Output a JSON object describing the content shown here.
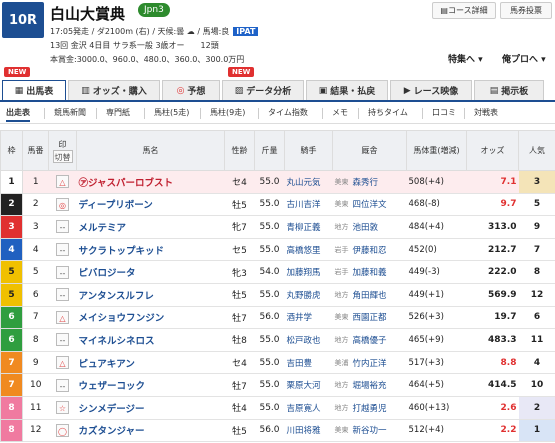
{
  "race": {
    "number": "10R",
    "title": "白山大賞典",
    "grade": "Jpn3",
    "line1": "17:05発走 / ダ2100m (右) / 天候:曇 ☁ / 馬場:良",
    "ipat": "IPAT",
    "line2": "13回 金沢 4日目 サラ系一般 3歳オー　　12頭",
    "line3": "本賞金:3000.0、960.0、480.0、360.0、300.0万円"
  },
  "top_buttons": {
    "course": "コース詳細",
    "vote": "馬券投票"
  },
  "top_links": {
    "special": "特集へ",
    "mypro": "俺プロへ"
  },
  "tabs": [
    "出馬表",
    "オッズ・購入",
    "予想",
    "データ分析",
    "結果・払戻",
    "レース映像",
    "掲示板"
  ],
  "new_label": "NEW",
  "subtabs": [
    "出走表",
    "競馬新聞",
    "専門紙",
    "馬柱(5走)",
    "馬柱(9走)",
    "タイム指数",
    "メモ",
    "持ちタイム",
    "口コミ",
    "対戦表"
  ],
  "headers": {
    "waku": "枠",
    "umaban": "馬番",
    "mark": "印",
    "mark_sub": "切替",
    "name": "馬名",
    "sexage": "性齢",
    "kinryo": "斤量",
    "jockey": "騎手",
    "trainer": "厩舎",
    "weight": "馬体重(増減)",
    "odds": "オッズ",
    "ninki": "人気"
  },
  "colors": {
    "w1": "#ffffff",
    "w2": "#222222",
    "w3": "#e03030",
    "w4": "#2060c0",
    "w5": "#f0c000",
    "w6": "#2f9e3f",
    "w7": "#f08a20",
    "w8": "#f07aa0"
  },
  "horses": [
    {
      "waku": "1",
      "umaban": "1",
      "mark": "△",
      "name": "㋐ジャスパーロブスト",
      "sexage": "セ4",
      "kinryo": "55.0",
      "jockey": "丸山元気",
      "belong": "美東",
      "trainer": "森秀行",
      "weight": "508(+4)",
      "odds": "7.1",
      "ninki": "3"
    },
    {
      "waku": "2",
      "umaban": "2",
      "mark": "◎",
      "name": "ディープリボーン",
      "sexage": "牡5",
      "kinryo": "55.0",
      "jockey": "古川吉洋",
      "belong": "美東",
      "trainer": "四位洋文",
      "weight": "468(-8)",
      "odds": "9.7",
      "ninki": "5"
    },
    {
      "waku": "3",
      "umaban": "3",
      "mark": "--",
      "name": "メルテミア",
      "sexage": "牝7",
      "kinryo": "55.0",
      "jockey": "青柳正義",
      "belong": "地方",
      "trainer": "池田敦",
      "weight": "484(+4)",
      "odds": "313.0",
      "ninki": "9"
    },
    {
      "waku": "4",
      "umaban": "4",
      "mark": "--",
      "name": "サクラトップキッド",
      "sexage": "セ5",
      "kinryo": "55.0",
      "jockey": "高橋悠里",
      "belong": "岩手",
      "trainer": "伊藤和忍",
      "weight": "452(0)",
      "odds": "212.7",
      "ninki": "7"
    },
    {
      "waku": "5",
      "umaban": "5",
      "mark": "--",
      "name": "ピバロジータ",
      "sexage": "牝3",
      "kinryo": "54.0",
      "jockey": "加藤翔馬",
      "belong": "岩手",
      "trainer": "加藤和義",
      "weight": "449(-3)",
      "odds": "222.0",
      "ninki": "8"
    },
    {
      "waku": "5",
      "umaban": "6",
      "mark": "--",
      "name": "アンタンスルフレ",
      "sexage": "牡5",
      "kinryo": "55.0",
      "jockey": "丸野勝虎",
      "belong": "地方",
      "trainer": "角田輝也",
      "weight": "449(+1)",
      "odds": "569.9",
      "ninki": "12"
    },
    {
      "waku": "6",
      "umaban": "7",
      "mark": "△",
      "name": "メイショウフンジン",
      "sexage": "牡7",
      "kinryo": "56.0",
      "jockey": "酒井学",
      "belong": "美東",
      "trainer": "西園正都",
      "weight": "526(+3)",
      "odds": "19.7",
      "ninki": "6"
    },
    {
      "waku": "6",
      "umaban": "8",
      "mark": "--",
      "name": "マイネルシネロス",
      "sexage": "牡8",
      "kinryo": "55.0",
      "jockey": "松戸政也",
      "belong": "地方",
      "trainer": "高橋優子",
      "weight": "465(+9)",
      "odds": "483.3",
      "ninki": "11"
    },
    {
      "waku": "7",
      "umaban": "9",
      "mark": "△",
      "name": "ピュアキアン",
      "sexage": "セ4",
      "kinryo": "55.0",
      "jockey": "吉田豊",
      "belong": "美浦",
      "trainer": "竹内正洋",
      "weight": "517(+3)",
      "odds": "8.8",
      "ninki": "4"
    },
    {
      "waku": "7",
      "umaban": "10",
      "mark": "--",
      "name": "ウェザーコック",
      "sexage": "牡7",
      "kinryo": "55.0",
      "jockey": "栗原大河",
      "belong": "地方",
      "trainer": "堀場裕充",
      "weight": "464(+5)",
      "odds": "414.5",
      "ninki": "10"
    },
    {
      "waku": "8",
      "umaban": "11",
      "mark": "☆",
      "name": "シンメデージー",
      "sexage": "牡4",
      "kinryo": "55.0",
      "jockey": "吉原寛人",
      "belong": "地方",
      "trainer": "打越勇児",
      "weight": "460(+13)",
      "odds": "2.6",
      "ninki": "2"
    },
    {
      "waku": "8",
      "umaban": "12",
      "mark": "◯",
      "name": "カズタンジャー",
      "sexage": "牡5",
      "kinryo": "56.0",
      "jockey": "川田将雅",
      "belong": "美東",
      "trainer": "新谷功一",
      "weight": "512(+4)",
      "odds": "2.2",
      "ninki": "1"
    }
  ]
}
